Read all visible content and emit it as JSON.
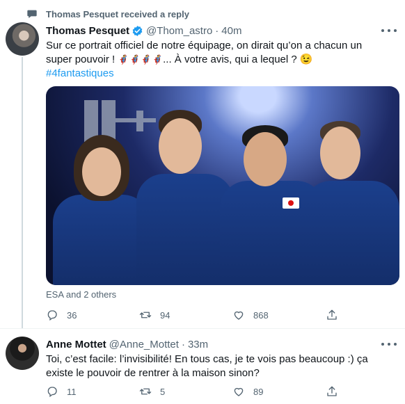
{
  "context": {
    "text": "Thomas Pesquet received a reply"
  },
  "tweet": {
    "name": "Thomas Pesquet",
    "handle": "@Thom_astro",
    "sep": "·",
    "time": "40m",
    "line1": "Sur ce portrait officiel de notre équipage, on dirait qu’on a chacun un",
    "line2_start": "super pouvoir ! ",
    "line2_emojis": "🦸🦸🦸🦸",
    "line2_end": "... À votre avis, qui a lequel ? 😉",
    "hashtag": "#4fantastiques",
    "credit": "ESA and 2 others",
    "replies": "36",
    "retweets": "94",
    "likes": "868"
  },
  "reply": {
    "name": "Anne Mottet",
    "handle": "@Anne_Mottet",
    "sep": "·",
    "time": "33m",
    "line1": "Toi, c’est facile: l’invisibilité! En tous cas, je te vois pas beaucoup :) ça",
    "line2": "existe le pouvoir de rentrer à la maison sinon?",
    "replies": "11",
    "retweets": "5",
    "likes": "89"
  },
  "colors": {
    "link": "#1d9bf0",
    "muted": "#536471",
    "verified": "#1d9bf0"
  }
}
